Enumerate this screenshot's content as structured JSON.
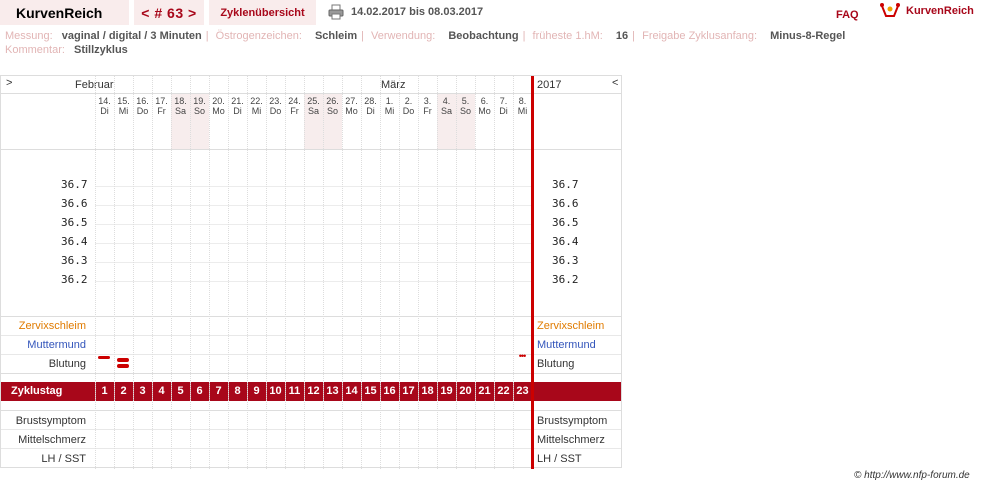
{
  "header": {
    "brand": "KurvenReich",
    "nav_label": "< # 63 >",
    "cycle_overview": "Zyklenübersicht",
    "date_range": "14.02.2017 bis 08.03.2017",
    "faq": "FAQ",
    "logo_text": "KurvenReich"
  },
  "info": {
    "messung_label": "Messung:",
    "messung": "vaginal / digital / 3 Minuten",
    "oestrogen_label": "Östrogenzeichen:",
    "oestrogen": "Schleim",
    "verwendung_label": "Verwendung:",
    "verwendung": "Beobachtung",
    "hm_label": "früheste 1.hM:",
    "hm": "16",
    "freigabe_label": "Freigabe Zyklusanfang:",
    "freigabe": "Minus-8-Regel",
    "kommentar_label": "Kommentar:",
    "kommentar": "Stillzyklus"
  },
  "chart": {
    "arrow_left": ">",
    "arrow_right": "<",
    "months": {
      "feb": "Februar",
      "mar": "März",
      "year": "2017"
    },
    "days": [
      {
        "n": "14.",
        "d": "Di",
        "we": false
      },
      {
        "n": "15.",
        "d": "Mi",
        "we": false
      },
      {
        "n": "16.",
        "d": "Do",
        "we": false
      },
      {
        "n": "17.",
        "d": "Fr",
        "we": false
      },
      {
        "n": "18.",
        "d": "Sa",
        "we": true
      },
      {
        "n": "19.",
        "d": "So",
        "we": true
      },
      {
        "n": "20.",
        "d": "Mo",
        "we": false
      },
      {
        "n": "21.",
        "d": "Di",
        "we": false
      },
      {
        "n": "22.",
        "d": "Mi",
        "we": false
      },
      {
        "n": "23.",
        "d": "Do",
        "we": false
      },
      {
        "n": "24.",
        "d": "Fr",
        "we": false
      },
      {
        "n": "25.",
        "d": "Sa",
        "we": true
      },
      {
        "n": "26.",
        "d": "So",
        "we": true
      },
      {
        "n": "27.",
        "d": "Mo",
        "we": false
      },
      {
        "n": "28.",
        "d": "Di",
        "we": false
      },
      {
        "n": "1.",
        "d": "Mi",
        "we": false
      },
      {
        "n": "2.",
        "d": "Do",
        "we": false
      },
      {
        "n": "3.",
        "d": "Fr",
        "we": false
      },
      {
        "n": "4.",
        "d": "Sa",
        "we": true
      },
      {
        "n": "5.",
        "d": "So",
        "we": true
      },
      {
        "n": "6.",
        "d": "Mo",
        "we": false
      },
      {
        "n": "7.",
        "d": "Di",
        "we": false
      },
      {
        "n": "8.",
        "d": "Mi",
        "we": false
      }
    ],
    "temps": [
      "36.7",
      "36.6",
      "36.5",
      "36.4",
      "36.3",
      "36.2"
    ],
    "rows": {
      "zervix": "Zervixschleim",
      "mutter": "Muttermund",
      "blutung": "Blutung",
      "zyklustag": "Zyklustag",
      "brust": "Brustsymptom",
      "mittel": "Mittelschmerz",
      "lh": "LH / SST"
    },
    "cycle_days": [
      "1",
      "2",
      "3",
      "4",
      "5",
      "6",
      "7",
      "8",
      "9",
      "10",
      "11",
      "12",
      "13",
      "14",
      "15",
      "16",
      "17",
      "18",
      "19",
      "20",
      "21",
      "22",
      "23"
    ],
    "bleeding": [
      {
        "day": 1,
        "level": "light"
      },
      {
        "day": 2,
        "level": "heavy"
      },
      {
        "day": 23,
        "level": "spotting"
      }
    ],
    "colors": {
      "accent": "#a8071a",
      "zervix": "#e07b00",
      "mutter": "#3355bb",
      "redline": "#cc0000"
    }
  },
  "copyright": "© http://www.nfp-forum.de"
}
